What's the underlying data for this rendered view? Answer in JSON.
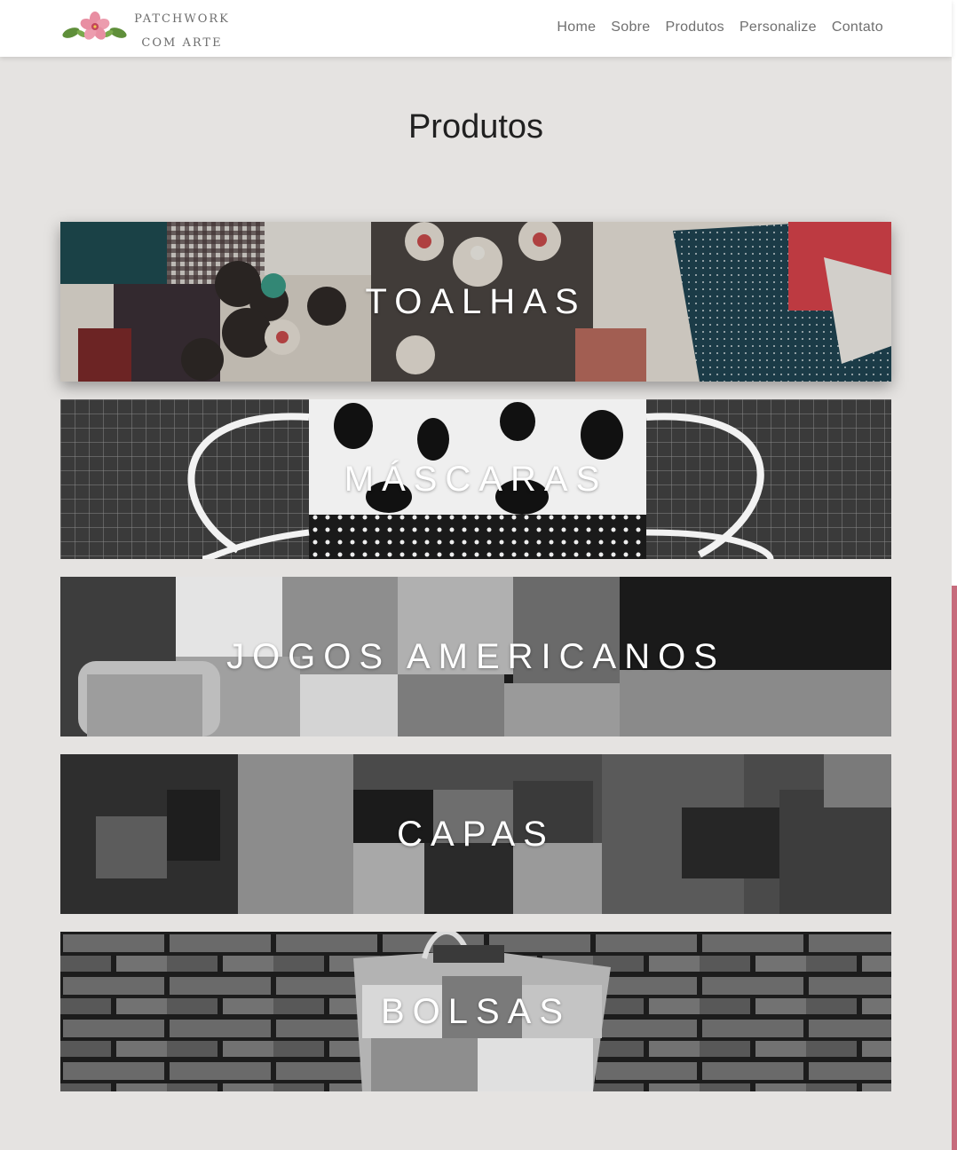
{
  "header": {
    "logo_line1": "PATCHWORK",
    "logo_line2": "COM ARTE",
    "nav": [
      {
        "label": "Home"
      },
      {
        "label": "Sobre"
      },
      {
        "label": "Produtos"
      },
      {
        "label": "Personalize"
      },
      {
        "label": "Contato"
      }
    ]
  },
  "main": {
    "title": "Produtos",
    "categories": [
      {
        "label": "TOALHAS"
      },
      {
        "label": "MÁSCARAS"
      },
      {
        "label": "JOGOS AMERICANOS"
      },
      {
        "label": "CAPAS"
      },
      {
        "label": "BOLSAS"
      }
    ]
  },
  "colors": {
    "page_background": "#e5e3e1",
    "header_background": "#ffffff",
    "nav_text": "#6f6f6f",
    "scrollbar_thumb": "#c66b7c",
    "banner_text": "#ffffff"
  },
  "icons": [
    "flower-leaves-logo-icon"
  ]
}
